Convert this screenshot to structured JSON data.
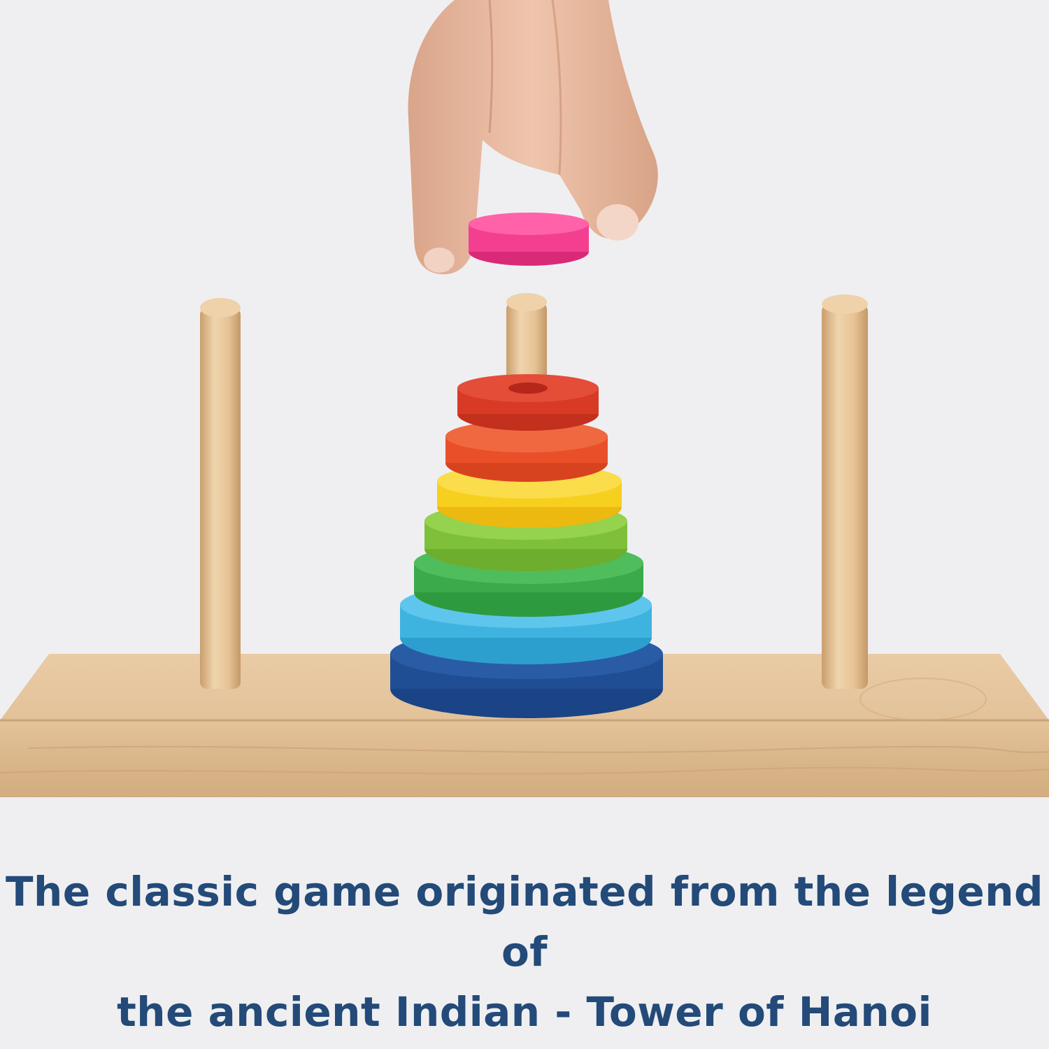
{
  "caption": {
    "line1": "The classic game originated from the legend of",
    "line2": "the ancient Indian - Tower of Hanoi"
  },
  "colors": {
    "background": "#efeff1",
    "caption_text": "#234a78",
    "wood": "#e2c096",
    "rings_bottom_to_top": [
      "#1f4e94",
      "#3fb3e0",
      "#3aaa4a",
      "#7fc03a",
      "#f7cf1e",
      "#e9502a",
      "#d83a26"
    ],
    "held_ring": "#f43f90"
  },
  "scene": {
    "pegs": 3,
    "rings_on_middle_peg": 7,
    "held_ring_count": 1
  }
}
